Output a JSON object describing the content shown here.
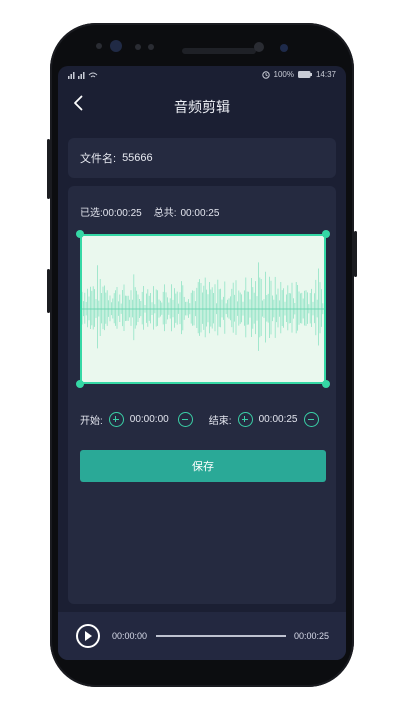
{
  "statusbar": {
    "signal_text": "ℹ⋁†",
    "battery": "100%",
    "time": "14:37"
  },
  "header": {
    "title": "音频剪辑"
  },
  "file": {
    "label": "文件名:",
    "name": "55666"
  },
  "selection": {
    "selected_label": "已选:",
    "selected_time": "00:00:25",
    "total_label": "总共:",
    "total_time": "00:00:25"
  },
  "trim": {
    "start_label": "开始:",
    "start_time": "00:00:00",
    "end_label": "结束:",
    "end_time": "00:00:25"
  },
  "save_label": "保存",
  "player": {
    "current_time": "00:00:00",
    "total_time": "00:00:25",
    "progress": 0
  },
  "colors": {
    "accent": "#35d8a5",
    "button": "#2aa997",
    "background": "#1b1f33",
    "card": "#252a40"
  },
  "icons": {
    "back": "chevron-left-icon",
    "play": "play-icon",
    "plus": "plus-circle-icon",
    "minus": "minus-circle-icon"
  }
}
